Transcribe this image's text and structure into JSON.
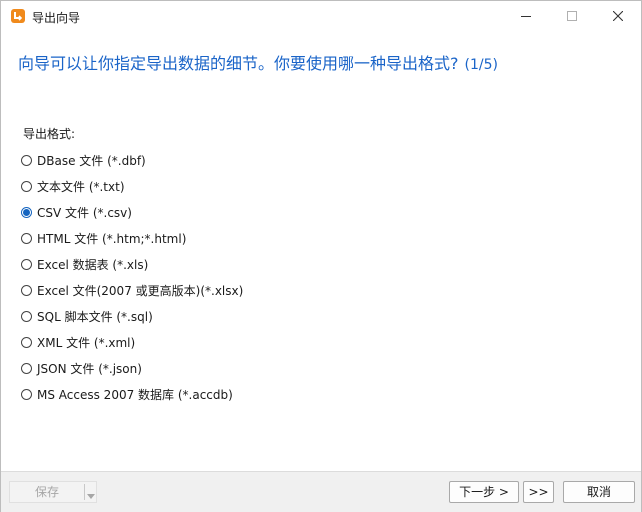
{
  "window": {
    "title": "导出向导",
    "controls": {
      "minimize": "minimize",
      "maximize": "maximize",
      "close": "close"
    }
  },
  "heading": {
    "text": "向导可以让你指定导出数据的细节。你要使用哪一种导出格式?",
    "step": "(1/5)"
  },
  "format": {
    "label": "导出格式:",
    "selected": "CSV 文件 (*.csv)",
    "options": [
      {
        "label": "DBase 文件 (*.dbf)",
        "checked": false
      },
      {
        "label": "文本文件 (*.txt)",
        "checked": false
      },
      {
        "label": "CSV 文件 (*.csv)",
        "checked": true
      },
      {
        "label": "HTML 文件 (*.htm;*.html)",
        "checked": false
      },
      {
        "label": "Excel 数据表 (*.xls)",
        "checked": false
      },
      {
        "label": "Excel 文件(2007 或更高版本)(*.xlsx)",
        "checked": false
      },
      {
        "label": "SQL 脚本文件 (*.sql)",
        "checked": false
      },
      {
        "label": "XML 文件 (*.xml)",
        "checked": false
      },
      {
        "label": "JSON 文件 (*.json)",
        "checked": false
      },
      {
        "label": "MS Access 2007 数据库 (*.accdb)",
        "checked": false
      }
    ]
  },
  "footer": {
    "save_label": "保存",
    "next_label": "下一步 >",
    "skip_label": ">>",
    "cancel_label": "取消"
  },
  "colors": {
    "accent": "#1a64c8",
    "radio_selected": "#1565c0",
    "icon_orange": "#f08a1c"
  },
  "icons": [
    "app-export-icon",
    "minimize-icon",
    "maximize-icon",
    "close-icon",
    "chevron-down-icon"
  ]
}
